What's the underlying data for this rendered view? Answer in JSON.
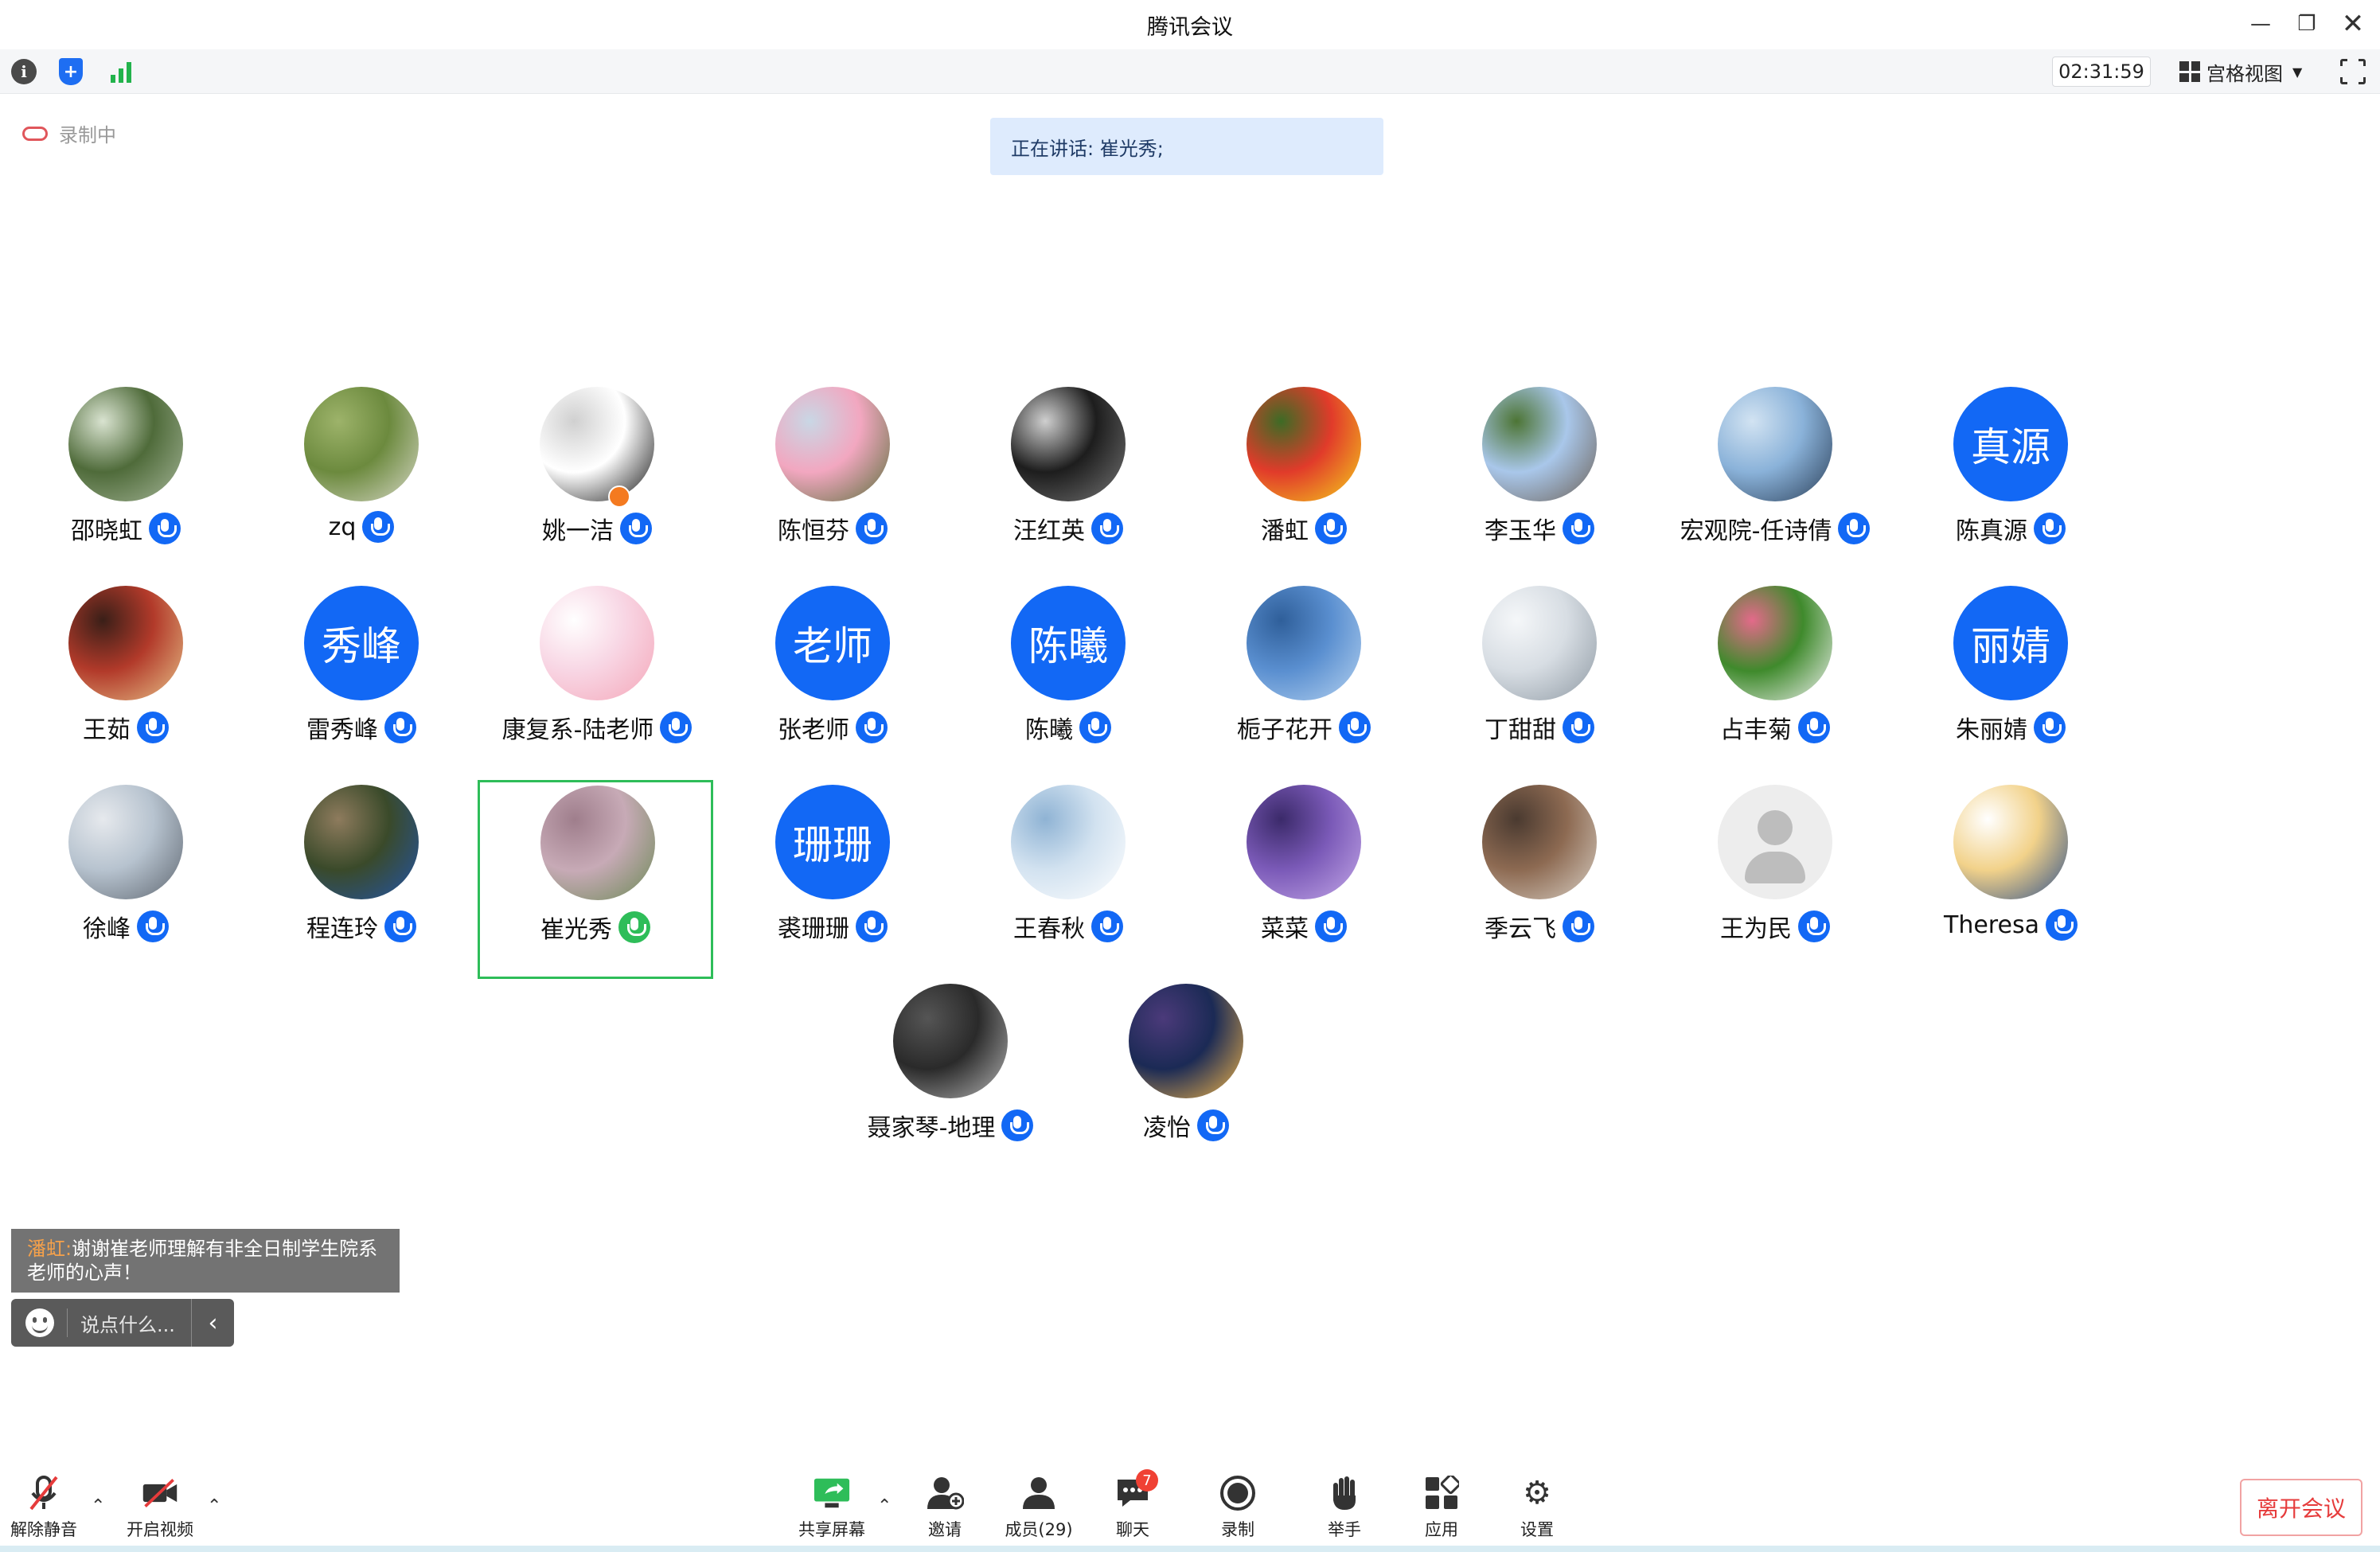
{
  "window": {
    "title": "腾讯会议"
  },
  "toolbar": {
    "timer": "02:31:59",
    "view_label": "宫格视图"
  },
  "recording": {
    "label": "录制中"
  },
  "speaking": {
    "text": "正在讲话: 崔光秀;"
  },
  "participants": [
    {
      "name": "邵晓虹",
      "avatar_kind": "photo",
      "colors": [
        "#4f6b3a",
        "#a7b79a",
        "#d9e3d0"
      ]
    },
    {
      "name": "zq",
      "avatar_kind": "photo",
      "colors": [
        "#6c8a3e",
        "#d8d8c8",
        "#9db36a"
      ]
    },
    {
      "name": "姚一洁",
      "avatar_kind": "photo",
      "colors": [
        "#ffffff",
        "#111111",
        "#d0d0d0"
      ],
      "badge": true
    },
    {
      "name": "陈恒芬",
      "avatar_kind": "photo",
      "colors": [
        "#f2a7c0",
        "#59703a",
        "#c9d7e5"
      ]
    },
    {
      "name": "汪红英",
      "avatar_kind": "photo",
      "colors": [
        "#1d1d1d",
        "#777777",
        "#cfcfcf"
      ]
    },
    {
      "name": "潘虹",
      "avatar_kind": "photo",
      "colors": [
        "#e13b2a",
        "#f5d21c",
        "#3d6b25"
      ]
    },
    {
      "name": "李玉华",
      "avatar_kind": "photo",
      "colors": [
        "#a9c7ea",
        "#6b6056",
        "#4d7535"
      ]
    },
    {
      "name": "宏观院-任诗倩",
      "avatar_kind": "photo",
      "colors": [
        "#8ab2d9",
        "#2a3e57",
        "#d2e3f2"
      ]
    },
    {
      "name": "陈真源",
      "avatar_kind": "text",
      "avatar_text": "真源"
    },
    {
      "name": "王茹",
      "avatar_kind": "photo",
      "colors": [
        "#b23a2a",
        "#e8c48a",
        "#3a1f18"
      ]
    },
    {
      "name": "雷秀峰",
      "avatar_kind": "text",
      "avatar_text": "秀峰"
    },
    {
      "name": "康复系-陆老师",
      "avatar_kind": "photo",
      "colors": [
        "#f8d6e4",
        "#f4a6b8",
        "#ffffff"
      ]
    },
    {
      "name": "张老师",
      "avatar_kind": "text",
      "avatar_text": "老师"
    },
    {
      "name": "陈曦",
      "avatar_kind": "text",
      "avatar_text": "陈曦"
    },
    {
      "name": "栀子花开",
      "avatar_kind": "photo",
      "colors": [
        "#5a8fd0",
        "#b5d2f0",
        "#2f5f9a"
      ]
    },
    {
      "name": "丁甜甜",
      "avatar_kind": "photo",
      "colors": [
        "#d7dde3",
        "#8e99a3",
        "#f5f7f9"
      ]
    },
    {
      "name": "占丰菊",
      "avatar_kind": "photo",
      "colors": [
        "#3f8a2c",
        "#f2f2f2",
        "#e36a8a"
      ]
    },
    {
      "name": "朱丽婧",
      "avatar_kind": "text",
      "avatar_text": "丽婧"
    },
    {
      "name": "徐峰",
      "avatar_kind": "photo",
      "colors": [
        "#b7c3cf",
        "#5e6670",
        "#e6e9ed"
      ]
    },
    {
      "name": "程连玲",
      "avatar_kind": "photo",
      "colors": [
        "#3a4a2a",
        "#2354a8",
        "#8e7b5d"
      ]
    },
    {
      "name": "崔光秀",
      "avatar_kind": "photo",
      "colors": [
        "#c7aab6",
        "#6b8a55",
        "#9f7e8c"
      ],
      "speaking": true
    },
    {
      "name": "裘珊珊",
      "avatar_kind": "text",
      "avatar_text": "珊珊"
    },
    {
      "name": "王春秋",
      "avatar_kind": "photo",
      "colors": [
        "#d2e2f0",
        "#ffffff",
        "#8fb3d4"
      ]
    },
    {
      "name": "菜菜",
      "avatar_kind": "photo",
      "colors": [
        "#7b5ab8",
        "#c4a8e8",
        "#3b2a6a"
      ]
    },
    {
      "name": "季云飞",
      "avatar_kind": "photo",
      "colors": [
        "#8d6a52",
        "#d8cfc4",
        "#4a3a30"
      ]
    },
    {
      "name": "王为民",
      "avatar_kind": "default"
    },
    {
      "name": "Theresa",
      "avatar_kind": "photo",
      "colors": [
        "#f2d28a",
        "#2d4f8a",
        "#ffffff"
      ]
    },
    {
      "name": "聂家琴-地理",
      "avatar_kind": "photo",
      "colors": [
        "#2a2a2a",
        "#b8b8b8",
        "#555555"
      ]
    },
    {
      "name": "凌怡",
      "avatar_kind": "photo",
      "colors": [
        "#1b2a55",
        "#f5b84a",
        "#4b3a7a"
      ]
    }
  ],
  "chat": {
    "sender": "潘虹:",
    "message": "谢谢崔老师理解有非全日制学生院系老师的心声！",
    "input_placeholder": "说点什么..."
  },
  "bottombar": {
    "unmute": "解除静音",
    "start_video": "开启视频",
    "share_screen": "共享屏幕",
    "invite": "邀请",
    "members": "成员(29)",
    "chat": "聊天",
    "chat_badge": "7",
    "record": "录制",
    "raise_hand": "举手",
    "apps": "应用",
    "settings": "设置",
    "leave": "离开会议"
  },
  "colors": {
    "accent": "#1268f5",
    "speaking": "#2ebd59",
    "danger": "#e63b3b"
  }
}
